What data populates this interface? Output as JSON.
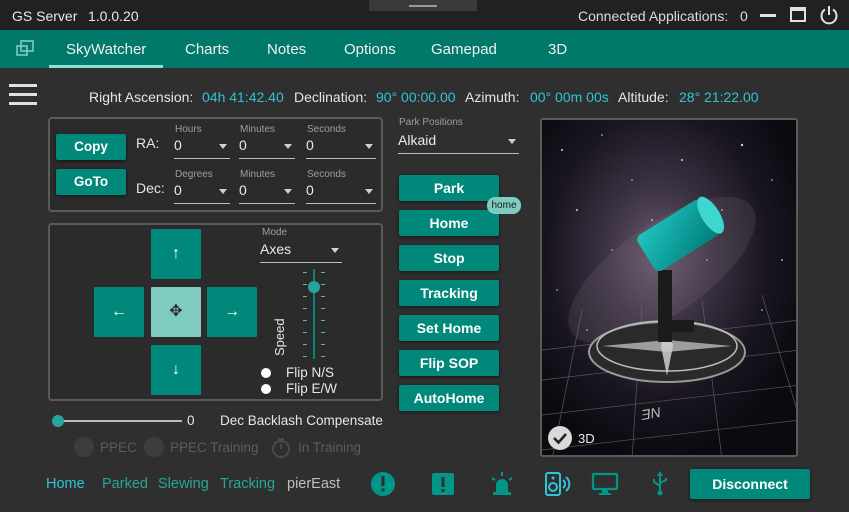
{
  "window": {
    "title": "GS Server",
    "version": "1.0.0.20",
    "connected_label": "Connected Applications:",
    "connected_count": "0"
  },
  "tabs": [
    {
      "label": "SkyWatcher",
      "active": true
    },
    {
      "label": "Charts"
    },
    {
      "label": "Notes"
    },
    {
      "label": "Options"
    },
    {
      "label": "Gamepad"
    },
    {
      "label": "3D"
    }
  ],
  "coords": {
    "ra_label": "Right Ascension:",
    "ra_value": "04h 41:42.40",
    "dec_label": "Declination:",
    "dec_value": "90° 00:00.00",
    "az_label": "Azimuth:",
    "az_value": "00° 00m 00s",
    "alt_label": "Altitude:",
    "alt_value": "28° 21:22.00"
  },
  "goto_panel": {
    "copy_label": "Copy",
    "goto_label": "GoTo",
    "ra_label": "RA:",
    "dec_label": "Dec:",
    "hours_label": "Hours",
    "minutes_label": "Minutes",
    "seconds_label": "Seconds",
    "degrees_label": "Degrees",
    "ra_hours": "0",
    "ra_minutes": "0",
    "ra_seconds": "0",
    "dec_degrees": "0",
    "dec_minutes": "0",
    "dec_seconds": "0"
  },
  "jog_panel": {
    "mode_label": "Mode",
    "mode_value": "Axes",
    "speed_label": "Speed",
    "flip_ns": "Flip N/S",
    "flip_ew": "Flip E/W",
    "up": "↑",
    "down": "↓",
    "left": "←",
    "right": "→",
    "center": "✥"
  },
  "backlash": {
    "value": "0",
    "label": "Dec Backlash Compensate"
  },
  "ppec": {
    "ppec": "PPEC",
    "training": "PPEC Training",
    "in_training": "In Training"
  },
  "park": {
    "positions_label": "Park Positions",
    "position_value": "Alkaid",
    "buttons": [
      "Park",
      "Home",
      "Stop",
      "Tracking",
      "Set Home",
      "Flip SOP",
      "AutoHome"
    ],
    "home_badge": "home"
  },
  "view3d": {
    "label": "3D",
    "checked": true
  },
  "status": {
    "home": "Home",
    "parked": "Parked",
    "slewing": "Slewing",
    "tracking": "Tracking",
    "pier": "pierEast",
    "disconnect": "Disconnect"
  },
  "colors": {
    "accent": "#00897b",
    "tabbar": "#00796b",
    "value_text": "#2ec4d6",
    "badge": "#7fcbc0"
  }
}
